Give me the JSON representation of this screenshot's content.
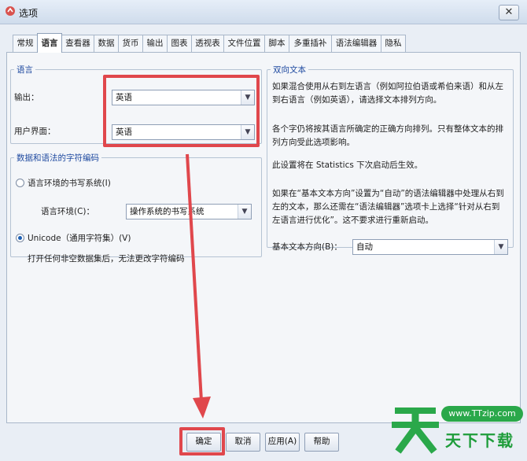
{
  "window": {
    "title": "选项",
    "close_glyph": "✕"
  },
  "tabs": [
    "常规",
    "语言",
    "查看器",
    "数据",
    "货币",
    "输出",
    "图表",
    "透视表",
    "文件位置",
    "脚本",
    "多重插补",
    "语法编辑器",
    "隐私"
  ],
  "active_tab": "语言",
  "language_group": {
    "legend": "语言",
    "output_label": "输出：",
    "output_value": "英语",
    "ui_label": "用户界面：",
    "ui_value": "英语"
  },
  "encoding_group": {
    "legend": "数据和语法的字符编码",
    "locale_option": "语言环境的书写系统(I)",
    "locale_field_label": "语言环境(C)：",
    "locale_value": "操作系统的书写系统",
    "unicode_option": "Unicode（通用字符集）(V)",
    "note": "打开任何非空数据集后，无法更改字符编码"
  },
  "bidi_group": {
    "legend": "双向文本",
    "para1": "如果混合使用从右到左语言（例如阿拉伯语或希伯来语）和从左到右语言（例如英语），请选择文本排列方向。",
    "para2": "各个字仍将按其语言所确定的正确方向排列。只有整体文本的排列方向受此选项影响。",
    "para3": "此设置将在 Statistics 下次启动后生效。",
    "para4": "如果在“基本文本方向”设置为“自动”的语法编辑器中处理从右到左的文本，那么还需在“语法编辑器”选项卡上选择“针对从右到左语言进行优化”。这不要求进行重新启动。",
    "direction_label": "基本文本方向(B)：",
    "direction_value": "自动"
  },
  "buttons": {
    "ok": "确定",
    "cancel": "取消",
    "apply": "应用(A)",
    "help": "帮助"
  },
  "watermark": {
    "glyph": "天",
    "url": "www.TTzip.com",
    "text": "天下下载"
  },
  "colors": {
    "highlight": "#e0474c",
    "accent": "#1f4aa0",
    "watermark_green": "#2aa84a"
  },
  "icons": {
    "dropdown": "▼"
  }
}
